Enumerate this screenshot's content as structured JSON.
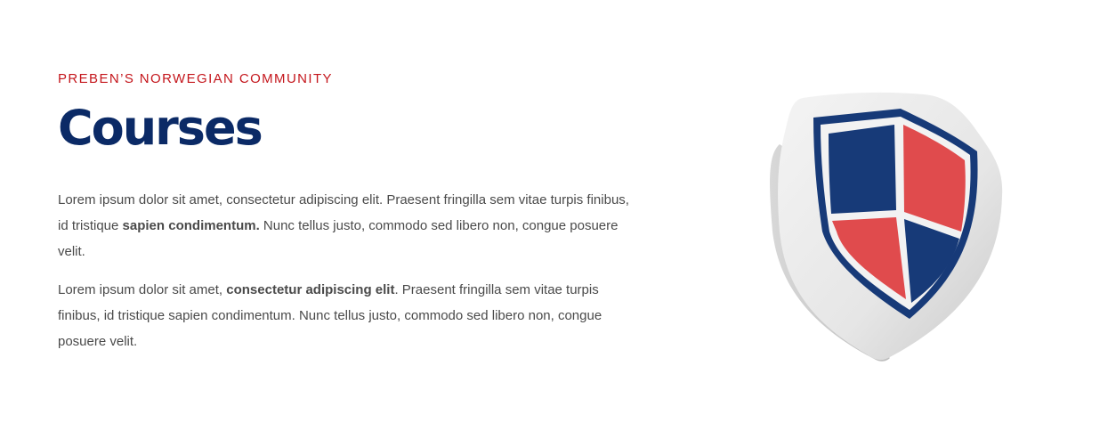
{
  "section": {
    "eyebrow": "PREBEN’S NORWEGIAN COMMUNITY",
    "title": "Courses",
    "paragraph1": {
      "part1": "Lorem ipsum dolor sit amet, consectetur adipiscing elit. Praesent fringilla sem vitae turpis finibus, id tristique ",
      "bold": "sapien condimentum.",
      "part2": " Nunc tellus justo, commodo sed libero non, congue posuere velit."
    },
    "paragraph2": {
      "part1": "Lorem ipsum dolor sit amet, ",
      "bold": "consectetur adipiscing elit",
      "part2": ". Praesent fringilla sem vitae turpis finibus, id tristique sapien condimentum. Nunc tellus justo, commodo sed libero non, congue posuere velit."
    }
  },
  "illustration": {
    "icon": "shield-icon",
    "colors": {
      "navy": "#173a78",
      "red": "#e04b4d",
      "body": "#e7e7e7"
    }
  },
  "colors": {
    "eyebrow": "#c4161c",
    "title": "#0b2a66",
    "text": "#4a4a4a"
  }
}
